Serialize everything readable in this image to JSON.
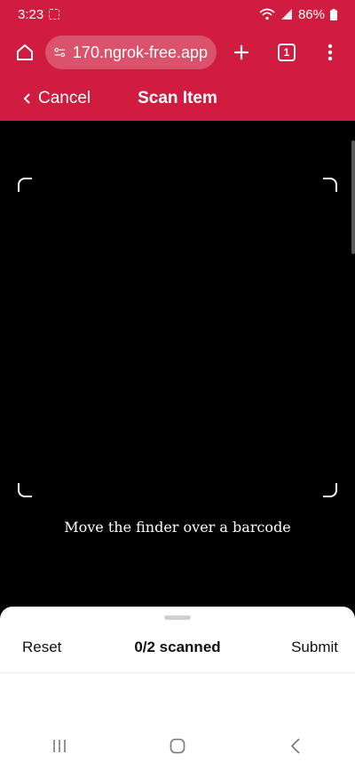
{
  "status_bar": {
    "time": "3:23",
    "battery": "86%"
  },
  "browser": {
    "url": "170.ngrok-free.app",
    "tab_count": "1"
  },
  "header": {
    "back_label": "Cancel",
    "title": "Scan Item"
  },
  "scanner": {
    "hint": "Move the finder over a barcode"
  },
  "sheet": {
    "reset_label": "Reset",
    "progress": "0/2 scanned",
    "submit_label": "Submit"
  },
  "colors": {
    "accent": "#cf1c3f",
    "camera_bg": "#000000",
    "sheet_bg": "#ffffff"
  },
  "icons": [
    "home-icon",
    "site-settings-icon",
    "new-tab-icon",
    "tab-switcher-icon",
    "more-menu-icon",
    "chevron-left-icon",
    "recents-icon",
    "home-nav-icon",
    "back-nav-icon"
  ]
}
